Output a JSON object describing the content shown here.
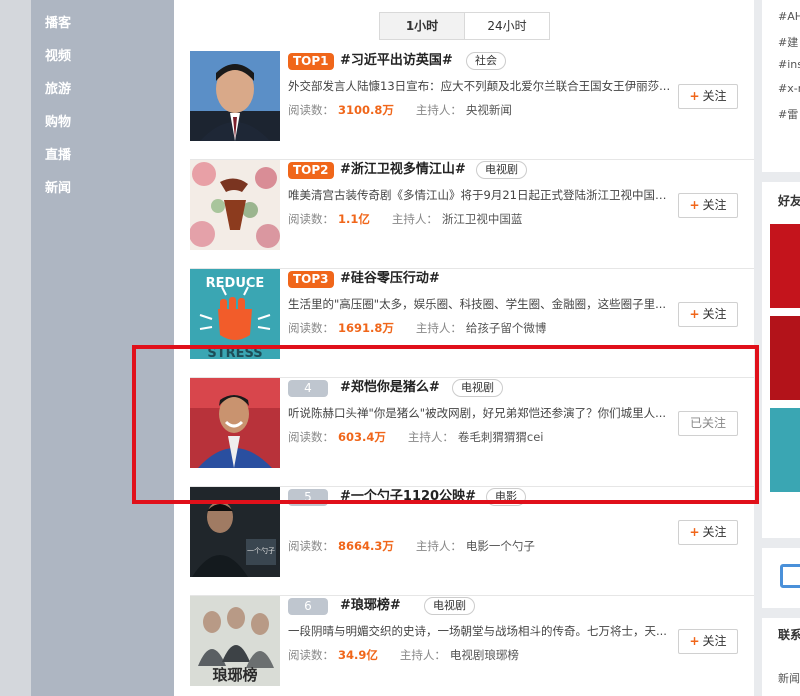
{
  "left_nav": {
    "items": [
      "播客",
      "视频",
      "旅游",
      "购物",
      "直播",
      "新闻"
    ]
  },
  "tabs": [
    "1小时",
    "24小时"
  ],
  "active_tab": "1小时",
  "labels": {
    "read_count": "阅读数：",
    "host": "主持人："
  },
  "topics": [
    {
      "rank": "TOP1",
      "title": "#习近平出访英国#",
      "tag": "社会",
      "desc": "外交部发言人陆慷13日宣布：应大不列颠及北爱尔兰联合王国女王伊丽莎...",
      "reads": "3100.8万",
      "host": "央视新闻",
      "follow": "关注"
    },
    {
      "rank": "TOP2",
      "title": "#浙江卫视多情江山#",
      "tag": "电视剧",
      "desc": "唯美清宫古装传奇剧《多情江山》将于9月21日起正式登陆浙江卫视中国蓝...",
      "reads": "1.1亿",
      "host": "浙江卫视中国蓝",
      "follow": "关注"
    },
    {
      "rank": "TOP3",
      "title": "#硅谷零压行动#",
      "tag": "",
      "desc": "生活里的\"高压圈\"太多，娱乐圈、科技圈、学生圈、金融圈，这些圈子里...",
      "reads": "1691.8万",
      "host": "给孩子留个微博",
      "follow": "关注"
    },
    {
      "rank": "4",
      "title": "#郑恺你是猪么#",
      "tag": "电视剧",
      "desc": "听说陈赫口头禅\"你是猪么\"被改网剧，好兄弟郑恺还参演了？你们城里人...",
      "reads": "603.4万",
      "host": "卷毛刺猬猬猬cei",
      "follow": "已关注"
    },
    {
      "rank": "5",
      "title": "#一个勺子1120公映#",
      "tag": "电影",
      "desc": "",
      "reads": "8664.3万",
      "host": "电影一个勺子",
      "follow": "关注"
    },
    {
      "rank": "6",
      "title": "#琅琊榜#",
      "tag": "电视剧",
      "desc": "一段阴晴与明媚交织的史诗，一场朝堂与战场相斗的传奇。七万将士，天...",
      "reads": "34.9亿",
      "host": "电视剧琅琊榜",
      "follow": "关注"
    }
  ],
  "thumb_text": {
    "reduce": "REDUCE",
    "stress": "STRESS"
  },
  "right_sidebar": {
    "hashtags": [
      "#AH",
      "#建",
      "#ins",
      "#x-n",
      "#雷"
    ],
    "friends_head": "好友",
    "contact_head": "联系",
    "news": "新闻"
  },
  "colors": {
    "accent": "#f0661a",
    "highlight": "#e0101a",
    "rank_gray": "#bfc6cf"
  }
}
